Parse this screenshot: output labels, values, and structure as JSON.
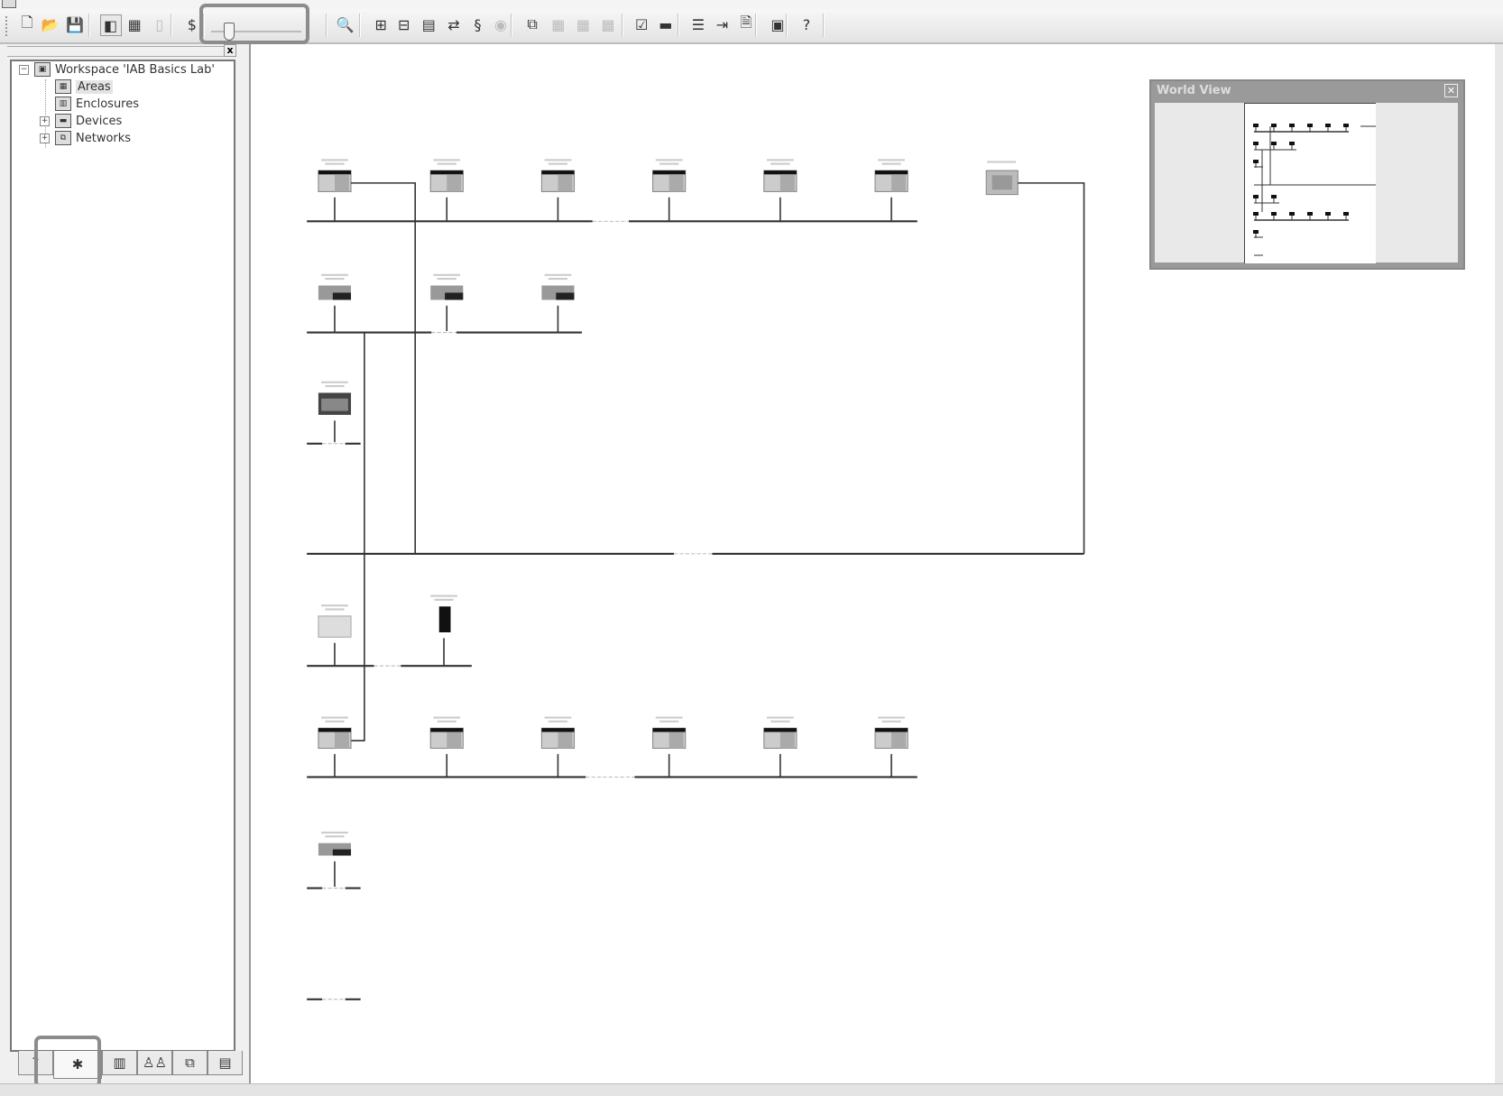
{
  "toolbar": {
    "buttons": [
      {
        "icon": "new-icon",
        "glyph": "🗋",
        "enabled": true
      },
      {
        "icon": "open-icon",
        "glyph": "📂",
        "enabled": true
      },
      {
        "icon": "save-icon",
        "glyph": "💾",
        "enabled": true
      },
      {
        "icon": "window-layout-icon",
        "glyph": "◧",
        "enabled": true,
        "pressed": true
      },
      {
        "icon": "properties-icon",
        "glyph": "▦",
        "enabled": true
      },
      {
        "icon": "blank-icon",
        "glyph": "▯",
        "enabled": false
      },
      {
        "icon": "price-icon",
        "glyph": "$",
        "enabled": true
      },
      {
        "icon": "zoom-icon",
        "glyph": "🔍",
        "enabled": true
      },
      {
        "icon": "layout-1-icon",
        "glyph": "⊞",
        "enabled": true
      },
      {
        "icon": "layout-2-icon",
        "glyph": "⊟",
        "enabled": true
      },
      {
        "icon": "layout-3-icon",
        "glyph": "▤",
        "enabled": true
      },
      {
        "icon": "route-icon",
        "glyph": "⇄",
        "enabled": true
      },
      {
        "icon": "signal-icon",
        "glyph": "§",
        "enabled": true
      },
      {
        "icon": "disc-icon",
        "glyph": "◉",
        "enabled": false
      },
      {
        "icon": "copy-icon",
        "glyph": "⧉",
        "enabled": true
      },
      {
        "icon": "grid-1-icon",
        "glyph": "▦",
        "enabled": false
      },
      {
        "icon": "grid-2-icon",
        "glyph": "▦",
        "enabled": false
      },
      {
        "icon": "grid-3-icon",
        "glyph": "▦",
        "enabled": false
      },
      {
        "icon": "check-icon",
        "glyph": "☑",
        "enabled": true
      },
      {
        "icon": "tag-icon",
        "glyph": "▬",
        "enabled": true
      },
      {
        "icon": "list-icon",
        "glyph": "☰",
        "enabled": true
      },
      {
        "icon": "export-icon",
        "glyph": "⇥",
        "enabled": true
      },
      {
        "icon": "document-icon",
        "glyph": "🗎",
        "enabled": true
      },
      {
        "icon": "report-icon",
        "glyph": "▣",
        "enabled": true
      },
      {
        "icon": "help-icon",
        "glyph": "?",
        "enabled": true
      }
    ],
    "zoom_slider": {
      "value_fraction": 0.15
    }
  },
  "tree": {
    "workspace": "Workspace 'IAB Basics Lab'",
    "items": [
      {
        "label": "Areas",
        "selected": true,
        "expandable": false
      },
      {
        "label": "Enclosures",
        "selected": false,
        "expandable": false
      },
      {
        "label": "Devices",
        "selected": false,
        "expandable": true
      },
      {
        "label": "Networks",
        "selected": false,
        "expandable": true
      }
    ]
  },
  "panel_tabs": [
    {
      "icon": "hardware-tab-icon",
      "glyph": "?"
    },
    {
      "icon": "network-tab-icon",
      "glyph": "✱",
      "active": true
    },
    {
      "icon": "catalog-tab-icon",
      "glyph": "▥"
    },
    {
      "icon": "users-tab-icon",
      "glyph": "♙♙"
    },
    {
      "icon": "topology-tab-icon",
      "glyph": "⧉"
    },
    {
      "icon": "systems-tab-icon",
      "glyph": "▤"
    }
  ],
  "world_view": {
    "title": "World View"
  },
  "colors": {
    "highlight": "#8c8c8c",
    "network_line": "#333333"
  }
}
